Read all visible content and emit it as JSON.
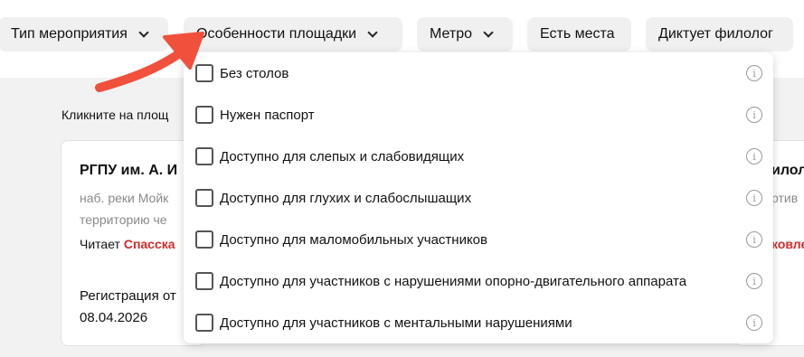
{
  "filters": [
    {
      "label": "Тип мероприятия",
      "has_dropdown": true
    },
    {
      "label": "Особенности площадки",
      "has_dropdown": true
    },
    {
      "label": "Метро",
      "has_dropdown": true
    },
    {
      "label": "Есть места",
      "has_dropdown": false
    },
    {
      "label": "Диктует филолог",
      "has_dropdown": false
    }
  ],
  "hint": "Кликните на площ",
  "card_left": {
    "title": "РГПУ им. А. И",
    "address_line1": "наб. реки Мойк",
    "address_line2": "территорию че",
    "reader_prefix": "Читает ",
    "reader_name": "Спасска",
    "reg_label": "Регистрация от",
    "reg_date": "08.04.2026"
  },
  "card_right": {
    "title": "илол",
    "address": "ртив",
    "reader_name": "ковле"
  },
  "dropdown": {
    "options": [
      {
        "label": "Без столов",
        "checked": false
      },
      {
        "label": "Нужен паспорт",
        "checked": false
      },
      {
        "label": "Доступно для слепых и слабовидящих",
        "checked": false
      },
      {
        "label": "Доступно для глухих и слабослышащих",
        "checked": false
      },
      {
        "label": "Доступно для маломобильных участников",
        "checked": false
      },
      {
        "label": "Доступно для участников с нарушениями опорно-двигательного аппарата",
        "checked": false
      },
      {
        "label": "Доступно для участников с ментальными нарушениями",
        "checked": false
      }
    ],
    "info_glyph": "i"
  },
  "colors": {
    "accent_red": "#d22b2b",
    "annotation_arrow": "#f0503c",
    "chip_bg": "#f0f0f0",
    "page_bg": "#f2f2f2"
  }
}
